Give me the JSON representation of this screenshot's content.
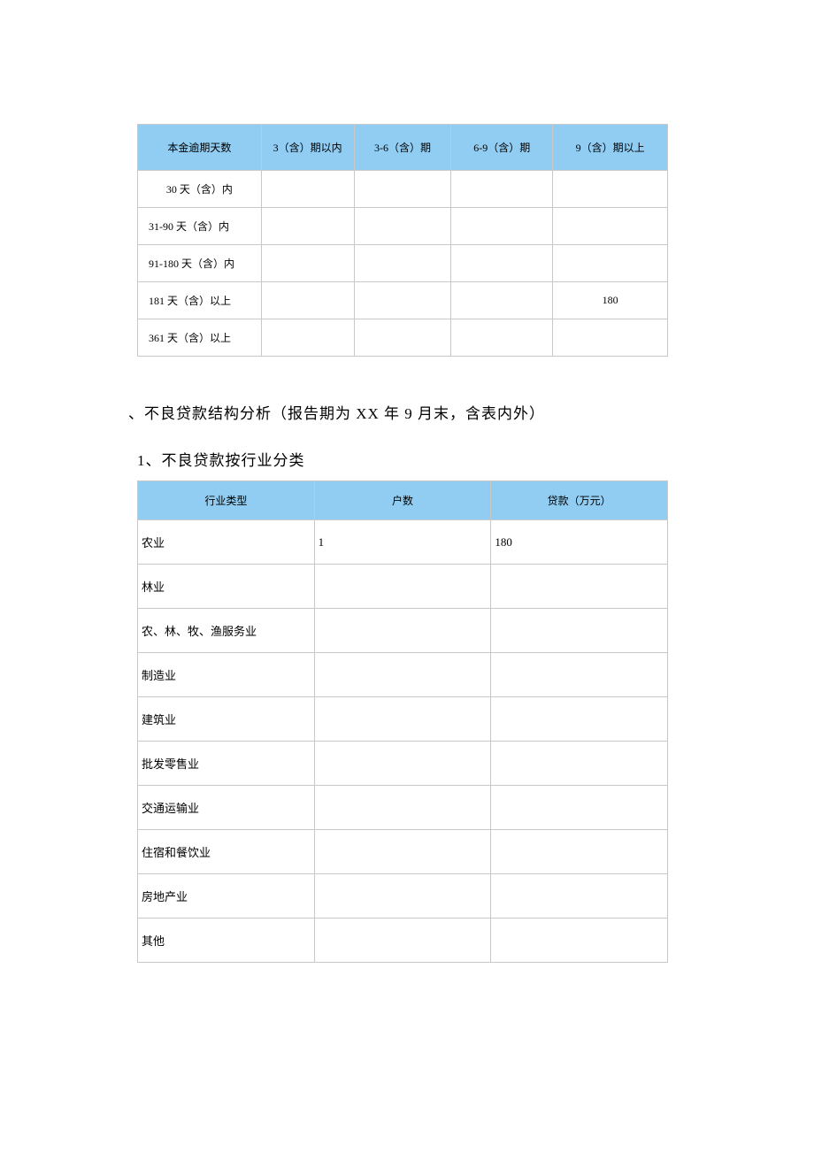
{
  "table1": {
    "headers": [
      "本金逾期天数",
      "3（含）期以内",
      "3-6（含）期",
      "6-9（含）期",
      "9（含）期以上"
    ],
    "rows": [
      {
        "label": "30 天（含）内",
        "c1": "",
        "c2": "",
        "c3": "",
        "c4": ""
      },
      {
        "label": "31-90 天（含）内",
        "c1": "",
        "c2": "",
        "c3": "",
        "c4": ""
      },
      {
        "label": "91-180 天（含）内",
        "c1": "",
        "c2": "",
        "c3": "",
        "c4": ""
      },
      {
        "label": "181 天（含）以上",
        "c1": "",
        "c2": "",
        "c3": "",
        "c4": "180"
      },
      {
        "label": "361 天（含）以上",
        "c1": "",
        "c2": "",
        "c3": "",
        "c4": ""
      }
    ]
  },
  "section_title": "、不良贷款结构分析（报告期为 XX 年 9 月末，含表内外）",
  "sub_title": "1、不良贷款按行业分类",
  "table2": {
    "headers": [
      "行业类型",
      "户数",
      "贷款（万元）"
    ],
    "rows": [
      {
        "label": "农业",
        "count": "1",
        "amount": "180"
      },
      {
        "label": "林业",
        "count": "",
        "amount": ""
      },
      {
        "label": "农、林、牧、渔服务业",
        "count": "",
        "amount": ""
      },
      {
        "label": "制造业",
        "count": "",
        "amount": ""
      },
      {
        "label": "建筑业",
        "count": "",
        "amount": ""
      },
      {
        "label": "批发零售业",
        "count": "",
        "amount": ""
      },
      {
        "label": "交通运输业",
        "count": "",
        "amount": ""
      },
      {
        "label": "住宿和餐饮业",
        "count": "",
        "amount": ""
      },
      {
        "label": "房地产业",
        "count": "",
        "amount": ""
      },
      {
        "label": "其他",
        "count": "",
        "amount": ""
      }
    ]
  }
}
